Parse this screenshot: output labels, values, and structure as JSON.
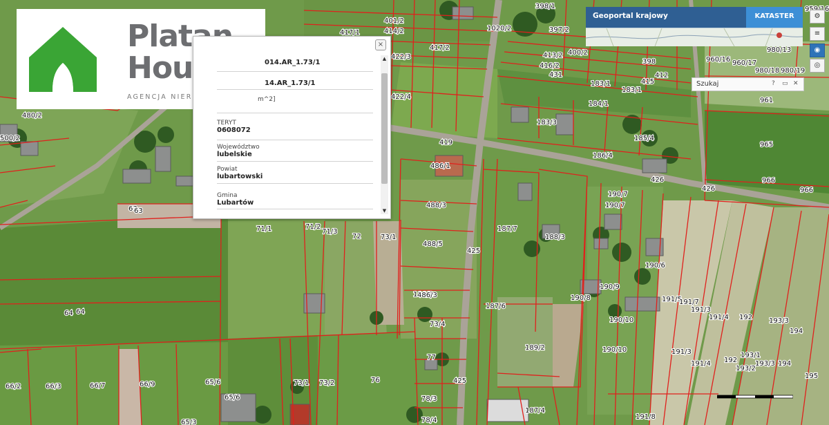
{
  "logo": {
    "line1": "Platan",
    "line2": "House",
    "tagline": "AGENCJA NIERUCHOMOŚCI",
    "brand_green": "#3aa535",
    "brand_gray": "#6d6e71"
  },
  "popup": {
    "partial_id_1": "014.AR_1.73/1",
    "partial_id_2": "14.AR_1.73/1",
    "partial_area_unit": "m^2]",
    "fields": [
      {
        "label": "TERYT",
        "value": "0608072"
      },
      {
        "label": "Województwo",
        "value": "lubelskie"
      },
      {
        "label": "Powiat",
        "value": "lubartowski"
      },
      {
        "label": "Gmina",
        "value": "Lubartów"
      }
    ],
    "close_symbol": "×"
  },
  "geoportal": {
    "title": "Geoportal krajowy",
    "layer": "KATASTER"
  },
  "search_panel": {
    "title": "Szukaj",
    "help": "?",
    "minimize": "▭",
    "close": "✕"
  },
  "parcel_labels": [
    "398/1",
    "401/2",
    "414/2",
    "417/1",
    "417/2",
    "1020/2",
    "397/2",
    "400/2",
    "413/2",
    "416/2",
    "431",
    "398",
    "412",
    "415",
    "959/16",
    "960/16",
    "960/17",
    "980/13",
    "980/18",
    "980/19",
    "961",
    "965",
    "966",
    "966",
    "426",
    "426",
    "422/3",
    "422/4",
    "419",
    "183/1",
    "183/1",
    "183/3",
    "184/1",
    "185/4",
    "186/4",
    "486/1",
    "488/3",
    "488/5",
    "187/7",
    "188/3",
    "190/7",
    "190/7",
    "190/8",
    "190/9",
    "190/6",
    "190/10",
    "190/10",
    "191/5",
    "191/7",
    "191/3",
    "191/4",
    "192",
    "193/3",
    "194",
    "191/3",
    "191/4",
    "192",
    "193/1",
    "193/2",
    "193/3",
    "194",
    "195",
    "189/2",
    "187/6",
    "186/3",
    "425",
    "425",
    "486/3",
    "73/4",
    "77",
    "73/1",
    "73/2",
    "76",
    "78/3",
    "78/4",
    "71/1",
    "71/2",
    "71/3",
    "72",
    "73/1",
    "64",
    "64",
    "66/2",
    "66/3",
    "66/7",
    "66/9",
    "65/6",
    "65/6",
    "63",
    "63",
    "480/2",
    "500/2",
    "187/4",
    "191/8",
    "65/3"
  ],
  "map_colors": {
    "parcel_line": "#e0201c",
    "field_green": "#5f8f3c",
    "road": "#a9a29a"
  }
}
